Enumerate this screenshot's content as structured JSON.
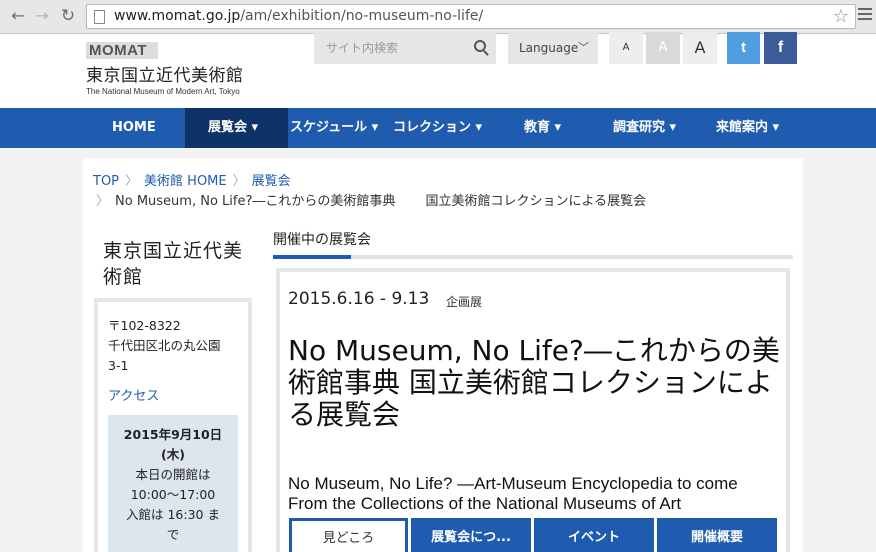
{
  "browser": {
    "url_domain": "www.momat.go.jp",
    "url_path": "/am/exhibition/no-museum-no-life/"
  },
  "header": {
    "logo_mark": "MOMAT",
    "logo_jp": "東京国立近代美術館",
    "logo_en": "The National Museum of Modern Art, Tokyo",
    "search_placeholder": "サイト内検索",
    "language_label": "Language",
    "font_sizes": [
      "A",
      "A",
      "A"
    ],
    "twitter_label": "t",
    "facebook_label": "f"
  },
  "nav": {
    "items": [
      {
        "label": "HOME"
      },
      {
        "label": "展覧会 ▾"
      },
      {
        "label": "スケジュール ▾"
      },
      {
        "label": "コレクション ▾"
      },
      {
        "label": "教育 ▾"
      },
      {
        "label": "調査研究 ▾"
      },
      {
        "label": "来館案内 ▾"
      }
    ],
    "active_index": 1
  },
  "breadcrumb": {
    "items": [
      "TOP",
      "美術館 HOME",
      "展覧会"
    ],
    "current_1": "No Museum, No Life?―これからの美術館事典",
    "current_2": "国立美術館コレクションによる展覧会"
  },
  "sidebar": {
    "title": "東京国立近代美術館",
    "postal": "〒102-8322",
    "address_1": "千代田区北の丸公園",
    "address_2": "3-1",
    "access_link": "アクセス",
    "today_date": "2015年9月10日",
    "today_day": "(木)",
    "open_text": "本日の開館は",
    "open_hours": "10:00〜17:00",
    "last_entry": "入館は 16:30 ま",
    "last_entry_2": "で"
  },
  "section": {
    "tab_label": "開催中の展覧会"
  },
  "exhibition": {
    "dates": "2015.6.16 - 9.13",
    "type": "企画展",
    "title_jp": "No Museum, No Life?―これからの美術館事典 国立美術館コレクションによる展覧会",
    "title_en": "No Museum, No Life? ―Art-Museum Encyclopedia to come From the Collections of the National Museums of Art",
    "tabs": [
      "見どころ",
      "展覧会につ...",
      "イベント",
      "開催概要"
    ],
    "selected_tab": 0
  }
}
